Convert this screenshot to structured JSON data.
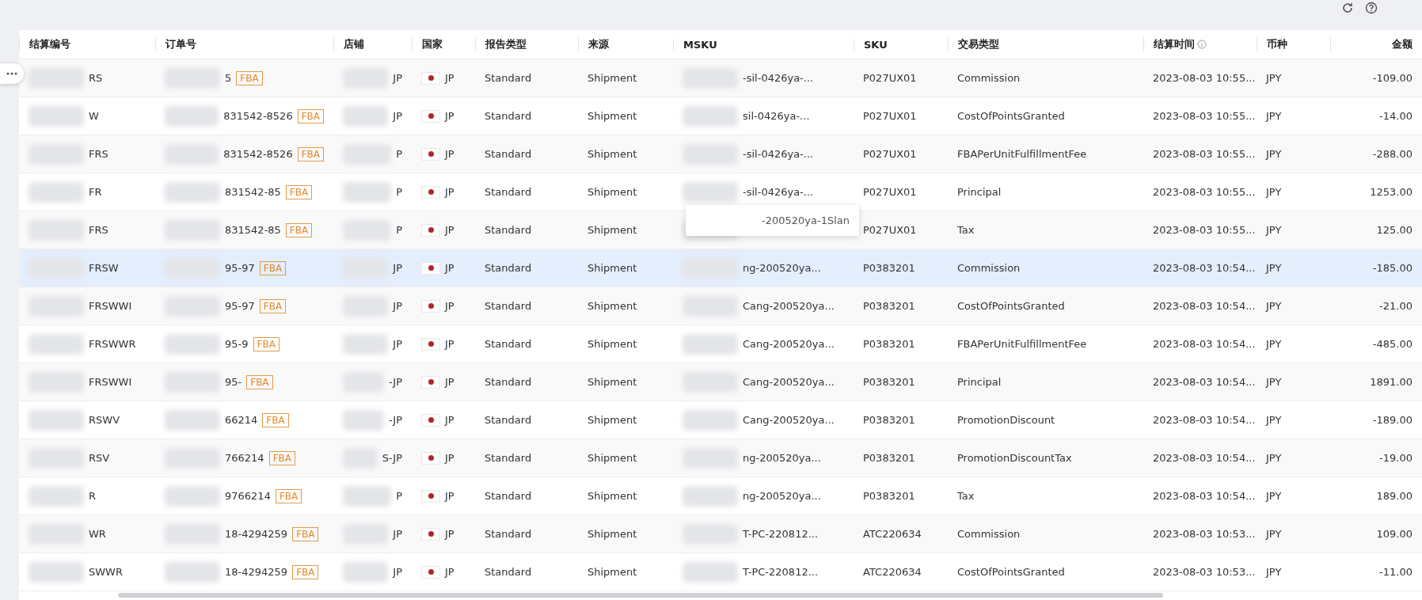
{
  "columns": [
    {
      "label": "结算编号",
      "kind": "text"
    },
    {
      "label": "订单号",
      "kind": "order"
    },
    {
      "label": "店铺",
      "kind": "text"
    },
    {
      "label": "国家",
      "kind": "country"
    },
    {
      "label": "报告类型",
      "kind": "text"
    },
    {
      "label": "来源",
      "kind": "text"
    },
    {
      "label": "MSKU",
      "kind": "text"
    },
    {
      "label": "SKU",
      "kind": "text"
    },
    {
      "label": "交易类型",
      "kind": "text"
    },
    {
      "label": "结算时间",
      "kind": "info"
    },
    {
      "label": "币种",
      "kind": "text"
    },
    {
      "label": "金额",
      "kind": "amount"
    }
  ],
  "rows": [
    {
      "hovered": false,
      "cells": [
        "RS",
        "5",
        "JP",
        "JP",
        "Standard",
        "Shipment",
        "-sil-0426ya-...",
        "P027UX01",
        "Commission",
        "2023-08-03 10:55...",
        "JPY",
        "-109.00"
      ],
      "tag": "FBA"
    },
    {
      "hovered": false,
      "cells": [
        "W",
        "831542-8526",
        "JP",
        "JP",
        "Standard",
        "Shipment",
        "sil-0426ya-...",
        "P027UX01",
        "CostOfPointsGranted",
        "2023-08-03 10:55...",
        "JPY",
        "-14.00"
      ],
      "tag": "FBA"
    },
    {
      "hovered": false,
      "cells": [
        "FRS",
        "831542-8526",
        "P",
        "JP",
        "Standard",
        "Shipment",
        "-sil-0426ya-...",
        "P027UX01",
        "FBAPerUnitFulfillmentFee",
        "2023-08-03 10:55...",
        "JPY",
        "-288.00"
      ],
      "tag": "FBA"
    },
    {
      "hovered": false,
      "cells": [
        "FR",
        "831542-85",
        "P",
        "JP",
        "Standard",
        "Shipment",
        "-sil-0426ya-...",
        "P027UX01",
        "Principal",
        "2023-08-03 10:55...",
        "JPY",
        "1253.00"
      ],
      "tag": "FBA"
    },
    {
      "hovered": false,
      "cells": [
        "FRS",
        "831542-85",
        "P",
        "JP",
        "Standard",
        "Shipment",
        "",
        "P027UX01",
        "Tax",
        "2023-08-03 10:55...",
        "JPY",
        "125.00"
      ],
      "tag": "FBA",
      "tooltip": "-200520ya-1Slan"
    },
    {
      "hovered": true,
      "cells": [
        "FRSW",
        "95-97",
        "JP",
        "JP",
        "Standard",
        "Shipment",
        "ng-200520ya...",
        "P0383201",
        "Commission",
        "2023-08-03 10:54...",
        "JPY",
        "-185.00"
      ],
      "tag": "FBA"
    },
    {
      "hovered": false,
      "cells": [
        "FRSWWI",
        "95-97",
        "JP",
        "JP",
        "Standard",
        "Shipment",
        "Cang-200520ya...",
        "P0383201",
        "CostOfPointsGranted",
        "2023-08-03 10:54...",
        "JPY",
        "-21.00"
      ],
      "tag": "FBA"
    },
    {
      "hovered": false,
      "cells": [
        "FRSWWR",
        "95-9",
        "JP",
        "JP",
        "Standard",
        "Shipment",
        "Cang-200520ya...",
        "P0383201",
        "FBAPerUnitFulfillmentFee",
        "2023-08-03 10:54...",
        "JPY",
        "-485.00"
      ],
      "tag": "FBA"
    },
    {
      "hovered": false,
      "cells": [
        "FRSWWI",
        "95-",
        "-JP",
        "JP",
        "Standard",
        "Shipment",
        "Cang-200520ya...",
        "P0383201",
        "Principal",
        "2023-08-03 10:54...",
        "JPY",
        "1891.00"
      ],
      "tag": "FBA"
    },
    {
      "hovered": false,
      "cells": [
        "RSWV",
        "66214",
        "-JP",
        "JP",
        "Standard",
        "Shipment",
        "Cang-200520ya...",
        "P0383201",
        "PromotionDiscount",
        "2023-08-03 10:54...",
        "JPY",
        "-189.00"
      ],
      "tag": "FBA"
    },
    {
      "hovered": false,
      "cells": [
        "RSV",
        "766214",
        "S-JP",
        "JP",
        "Standard",
        "Shipment",
        "ng-200520ya...",
        "P0383201",
        "PromotionDiscountTax",
        "2023-08-03 10:54...",
        "JPY",
        "-19.00"
      ],
      "tag": "FBA"
    },
    {
      "hovered": false,
      "cells": [
        "R",
        "9766214",
        "P",
        "JP",
        "Standard",
        "Shipment",
        "ng-200520ya...",
        "P0383201",
        "Tax",
        "2023-08-03 10:54...",
        "JPY",
        "189.00"
      ],
      "tag": "FBA"
    },
    {
      "hovered": false,
      "cells": [
        "WR",
        "18-4294259",
        "JP",
        "JP",
        "Standard",
        "Shipment",
        "T-PC-220812...",
        "ATC220634",
        "Commission",
        "2023-08-03 10:53...",
        "JPY",
        "109.00"
      ],
      "tag": "FBA"
    },
    {
      "hovered": false,
      "cells": [
        "SWWR",
        "18-4294259",
        "JP",
        "JP",
        "Standard",
        "Shipment",
        "T-PC-220812...",
        "ATC220634",
        "CostOfPointsGranted",
        "2023-08-03 10:53...",
        "JPY",
        "-11.00"
      ],
      "tag": "FBA"
    }
  ]
}
